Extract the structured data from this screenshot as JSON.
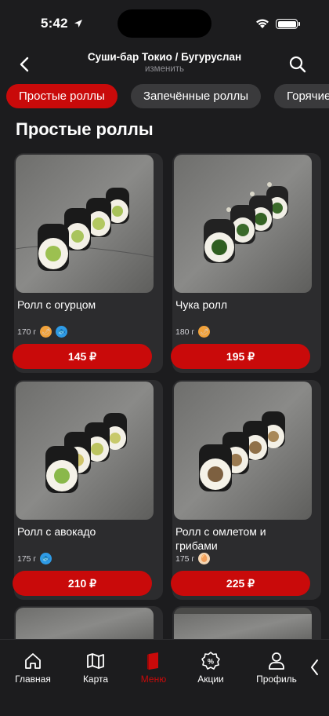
{
  "status_bar": {
    "time": "5:42"
  },
  "header": {
    "title": "Суши-бар Токио / Бугуруслан",
    "subtitle": "изменить"
  },
  "categories": [
    {
      "label": "Простые роллы",
      "active": true
    },
    {
      "label": "Запечённые роллы",
      "active": false
    },
    {
      "label": "Горячие",
      "active": false
    }
  ],
  "section_title": "Простые роллы",
  "products": [
    {
      "name": "Ролл с огурцом",
      "weight": "170 г",
      "badges": [
        "pepper-icon",
        "fish-icon"
      ],
      "price": "145 ₽"
    },
    {
      "name": "Чука ролл",
      "weight": "180 г",
      "badges": [
        "pepper-icon"
      ],
      "price": "195 ₽"
    },
    {
      "name": "Ролл с авокадо",
      "weight": "175 г",
      "badges": [
        "fish-icon"
      ],
      "price": "210 ₽"
    },
    {
      "name": "Ролл с омлетом и грибами",
      "weight": "175 г",
      "badges": [
        "egg-icon"
      ],
      "price": "225 ₽"
    }
  ],
  "tabs": [
    {
      "label": "Главная",
      "icon": "home-icon",
      "active": false
    },
    {
      "label": "Карта",
      "icon": "map-icon",
      "active": false
    },
    {
      "label": "Меню",
      "icon": "menu-icon",
      "active": true
    },
    {
      "label": "Акции",
      "icon": "discount-icon",
      "active": false
    },
    {
      "label": "Профиль",
      "icon": "profile-icon",
      "active": false
    }
  ],
  "colors": {
    "accent": "#c90a0a",
    "background": "#1c1c1e",
    "card": "#2c2c2e",
    "chip": "#3a3a3c"
  }
}
